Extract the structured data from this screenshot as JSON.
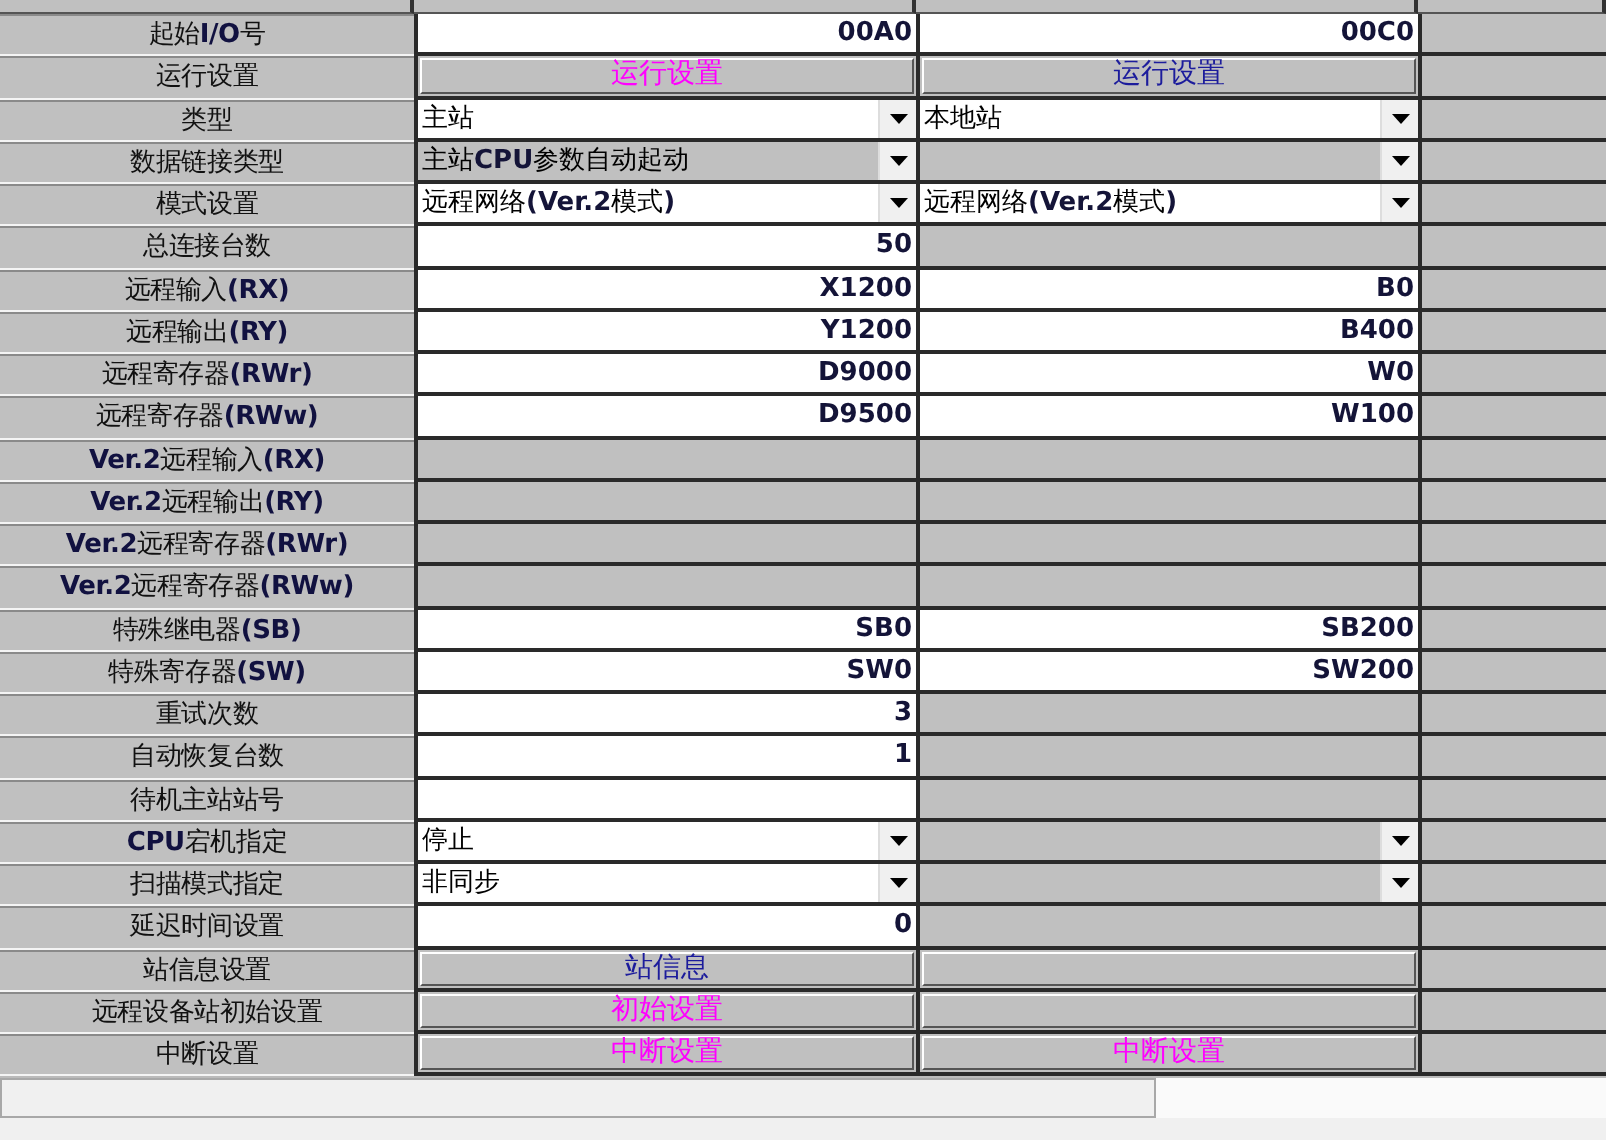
{
  "rows": [
    {
      "label": "起始**I/O**号",
      "cells": [
        {
          "kind": "number",
          "value": "00A0"
        },
        {
          "kind": "number",
          "value": "00C0"
        }
      ]
    },
    {
      "label": "运行设置",
      "cells": [
        {
          "kind": "button",
          "value": "运行设置",
          "color": "#ff00ff"
        },
        {
          "kind": "button",
          "value": "运行设置",
          "color": "#1c1c9c"
        }
      ]
    },
    {
      "label": "类型",
      "cells": [
        {
          "kind": "select",
          "value": "主站",
          "disabled": false
        },
        {
          "kind": "select",
          "value": "本地站",
          "disabled": false
        }
      ]
    },
    {
      "label": "数据链接类型",
      "cells": [
        {
          "kind": "select",
          "value": "主站**CPU**参数自动起动",
          "disabled": true
        },
        {
          "kind": "select",
          "disabled": true
        }
      ]
    },
    {
      "label": "模式设置",
      "cells": [
        {
          "kind": "select",
          "value": "远程网络**(Ver.2**模式**)**",
          "disabled": false
        },
        {
          "kind": "select",
          "value": "远程网络**(Ver.2**模式**)**",
          "disabled": false
        }
      ]
    },
    {
      "label": "总连接台数",
      "cells": [
        {
          "kind": "number",
          "value": "50"
        },
        {
          "kind": "none"
        }
      ]
    },
    {
      "label": "远程输入**(RX)**",
      "cells": [
        {
          "kind": "number",
          "value": "X1200"
        },
        {
          "kind": "number",
          "value": "B0"
        }
      ]
    },
    {
      "label": "远程输出**(RY)**",
      "cells": [
        {
          "kind": "number",
          "value": "Y1200"
        },
        {
          "kind": "number",
          "value": "B400"
        }
      ]
    },
    {
      "label": "远程寄存器**(RWr)**",
      "cells": [
        {
          "kind": "number",
          "value": "D9000"
        },
        {
          "kind": "number",
          "value": "W0"
        }
      ]
    },
    {
      "label": "远程寄存器**(RWw)**",
      "cells": [
        {
          "kind": "number",
          "value": "D9500"
        },
        {
          "kind": "number",
          "value": "W100"
        }
      ]
    },
    {
      "label": "**Ver.2**远程输入**(RX)**",
      "cells": [
        {
          "kind": "none"
        },
        {
          "kind": "none"
        }
      ]
    },
    {
      "label": "**Ver.2**远程输出**(RY)**",
      "cells": [
        {
          "kind": "none"
        },
        {
          "kind": "none"
        }
      ]
    },
    {
      "label": "**Ver.2**远程寄存器**(RWr)**",
      "cells": [
        {
          "kind": "none"
        },
        {
          "kind": "none"
        }
      ]
    },
    {
      "label": "**Ver.2**远程寄存器**(RWw)**",
      "cells": [
        {
          "kind": "none"
        },
        {
          "kind": "none"
        }
      ]
    },
    {
      "label": "特殊继电器**(SB)**",
      "cells": [
        {
          "kind": "number",
          "value": "SB0"
        },
        {
          "kind": "number",
          "value": "SB200"
        }
      ]
    },
    {
      "label": "特殊寄存器**(SW)**",
      "cells": [
        {
          "kind": "number",
          "value": "SW0"
        },
        {
          "kind": "number",
          "value": "SW200"
        }
      ]
    },
    {
      "label": "重试次数",
      "cells": [
        {
          "kind": "number",
          "value": "3"
        },
        {
          "kind": "none"
        }
      ]
    },
    {
      "label": "自动恢复台数",
      "cells": [
        {
          "kind": "number",
          "value": "1"
        },
        {
          "kind": "none"
        }
      ]
    },
    {
      "label": "待机主站站号",
      "cells": [
        {
          "kind": "number"
        },
        {
          "kind": "none"
        }
      ]
    },
    {
      "label": "**CPU**宕机指定",
      "cells": [
        {
          "kind": "select",
          "value": "停止",
          "disabled": false
        },
        {
          "kind": "select",
          "disabled": true
        }
      ]
    },
    {
      "label": "扫描模式指定",
      "cells": [
        {
          "kind": "select",
          "value": "非同步",
          "disabled": false
        },
        {
          "kind": "select",
          "disabled": true
        }
      ]
    },
    {
      "label": "延迟时间设置",
      "cells": [
        {
          "kind": "number",
          "value": "0"
        },
        {
          "kind": "none"
        }
      ]
    },
    {
      "label": "站信息设置",
      "cells": [
        {
          "kind": "button",
          "value": "站信息",
          "color": "#1c1c9c"
        },
        {
          "kind": "button"
        }
      ]
    },
    {
      "label": "远程设备站初始设置",
      "cells": [
        {
          "kind": "button",
          "value": "初始设置",
          "color": "#ff00ff"
        },
        {
          "kind": "button"
        }
      ]
    },
    {
      "label": "中断设置",
      "cells": [
        {
          "kind": "button",
          "value": "中断设置",
          "color": "#ff00ff"
        },
        {
          "kind": "button",
          "value": "中断设置",
          "color": "#ff00ff"
        }
      ]
    }
  ]
}
